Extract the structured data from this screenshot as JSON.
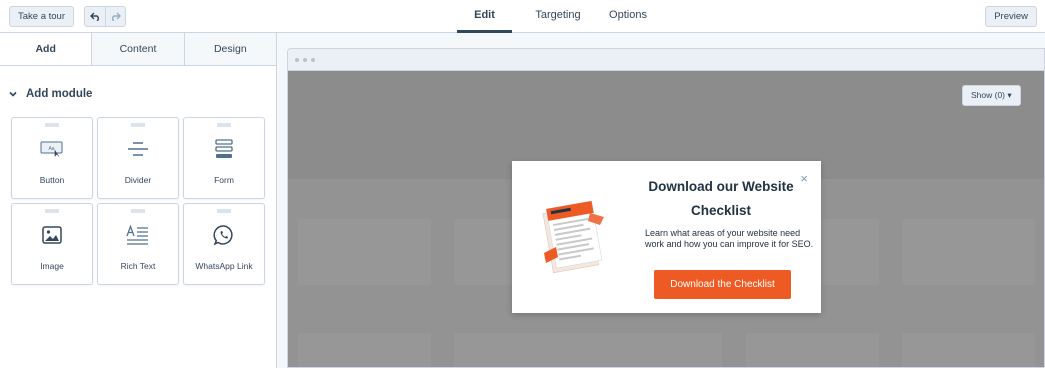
{
  "topbar": {
    "tour_label": "Take a tour",
    "tabs": [
      {
        "label": "Edit",
        "active": true
      },
      {
        "label": "Targeting",
        "active": false
      },
      {
        "label": "Options",
        "active": false
      }
    ],
    "preview_label": "Preview",
    "undo_icon": "undo-icon",
    "redo_icon": "redo-icon"
  },
  "sidebar": {
    "tabs": [
      {
        "label": "Add",
        "active": true
      },
      {
        "label": "Content",
        "active": false
      },
      {
        "label": "Design",
        "active": false
      }
    ],
    "section_title": "Add module",
    "modules": [
      {
        "label": "Button",
        "icon": "button-module-icon"
      },
      {
        "label": "Divider",
        "icon": "divider-module-icon"
      },
      {
        "label": "Form",
        "icon": "form-module-icon"
      },
      {
        "label": "Image",
        "icon": "image-module-icon"
      },
      {
        "label": "Rich Text",
        "icon": "rich-text-module-icon"
      },
      {
        "label": "WhatsApp Link",
        "icon": "whatsapp-icon"
      }
    ]
  },
  "canvas": {
    "show_label": "Show (0) ▾"
  },
  "popup": {
    "title": "Download our Website Checklist",
    "body": "Learn what areas of your website need work and how you can improve it for SEO.",
    "cta_label": "Download the Checklist",
    "close_glyph": "×",
    "button_color": "#ee5a24"
  }
}
